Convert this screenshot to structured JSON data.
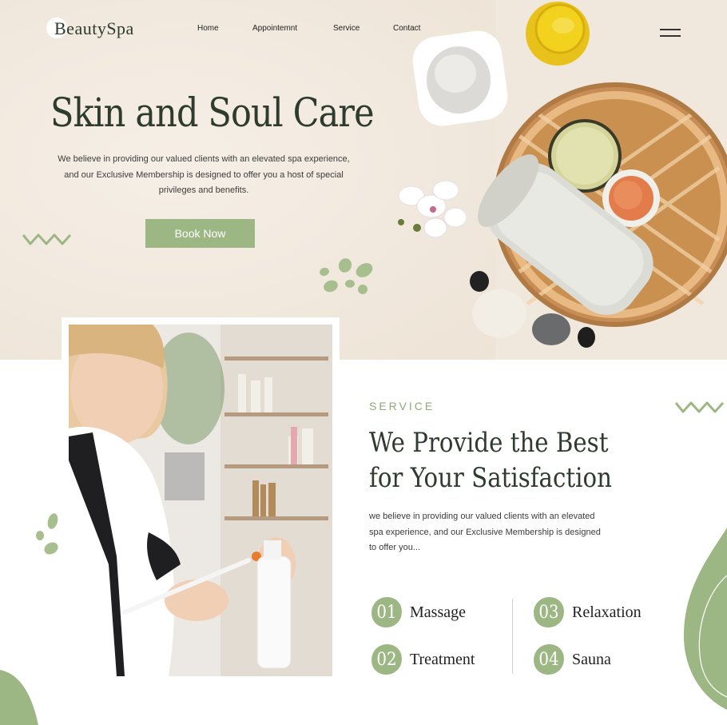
{
  "brand": {
    "name": "BeautySpa"
  },
  "nav": {
    "items": [
      "Home",
      "Appointemnt",
      "Service",
      "Contact"
    ]
  },
  "hero": {
    "title": "Skin and Soul Care",
    "description": "We believe in providing our valued clients with an elevated spa experience, and our Exclusive Membership is designed to offer you a host of special privileges and benefits.",
    "cta": "Book Now"
  },
  "service": {
    "eyebrow": "SERVICE",
    "title_line1": "We Provide the Best",
    "title_line2": "for Your Satisfaction",
    "description": "we believe in providing our valued clients with an elevated spa experience, and our Exclusive Membership is designed to offer you...",
    "items": [
      {
        "num": "01",
        "label": "Massage"
      },
      {
        "num": "03",
        "label": "Relaxation"
      },
      {
        "num": "02",
        "label": "Treatment"
      },
      {
        "num": "04",
        "label": "Sauna"
      }
    ]
  },
  "colors": {
    "accent_green": "#9db784",
    "hero_bg": "#f1e8dd",
    "heading": "#2e3b2e"
  },
  "icons": [
    "menu-icon",
    "zigzag-icon",
    "leaf-dots-icon"
  ]
}
